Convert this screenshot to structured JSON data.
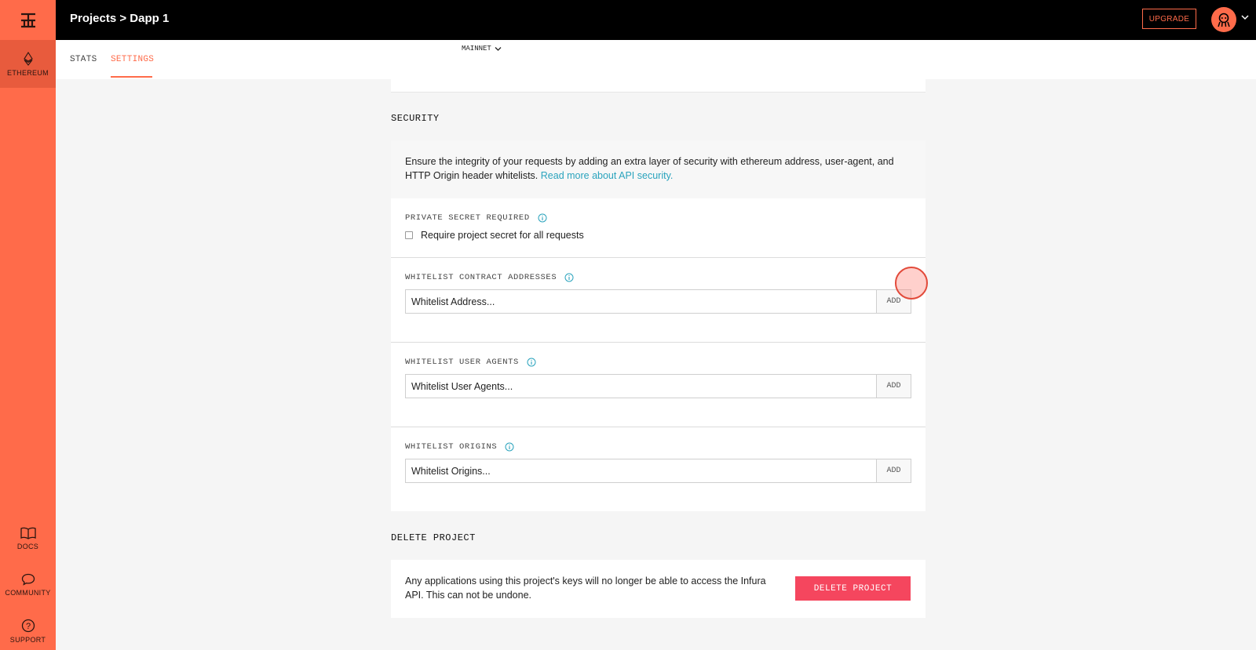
{
  "sidebar": {
    "items": [
      {
        "label": "ETHEREUM",
        "icon": "ethereum-icon"
      },
      {
        "label": "DOCS",
        "icon": "book-icon"
      },
      {
        "label": "COMMUNITY",
        "icon": "chat-icon"
      },
      {
        "label": "SUPPORT",
        "icon": "help-icon"
      }
    ]
  },
  "header": {
    "breadcrumb": "Projects > Dapp 1",
    "upgrade_label": "UPGRADE"
  },
  "subnav": {
    "tabs": [
      {
        "label": "STATS"
      },
      {
        "label": "SETTINGS"
      }
    ],
    "network": "MAINNET"
  },
  "security": {
    "title": "SECURITY",
    "intro": "Ensure the integrity of your requests by adding an extra layer of security with ethereum address, user-agent, and HTTP Origin header whitelists.",
    "intro_link": "Read more about API security.",
    "private_secret": {
      "label": "PRIVATE SECRET REQUIRED",
      "checkbox_label": "Require project secret for all requests"
    },
    "contract": {
      "label": "WHITELIST CONTRACT ADDRESSES",
      "placeholder": "Whitelist Address...",
      "add_label": "ADD"
    },
    "user_agents": {
      "label": "WHITELIST USER AGENTS",
      "placeholder": "Whitelist User Agents...",
      "add_label": "ADD"
    },
    "origins": {
      "label": "WHITELIST ORIGINS",
      "placeholder": "Whitelist Origins...",
      "add_label": "ADD"
    }
  },
  "delete": {
    "title": "DELETE PROJECT",
    "text": "Any applications using this project's keys will no longer be able to access the Infura API. This can not be undone.",
    "button_label": "DELETE PROJECT"
  },
  "colors": {
    "accent": "#ff6b4a",
    "danger": "#f5465e",
    "link": "#2aa3bd"
  }
}
